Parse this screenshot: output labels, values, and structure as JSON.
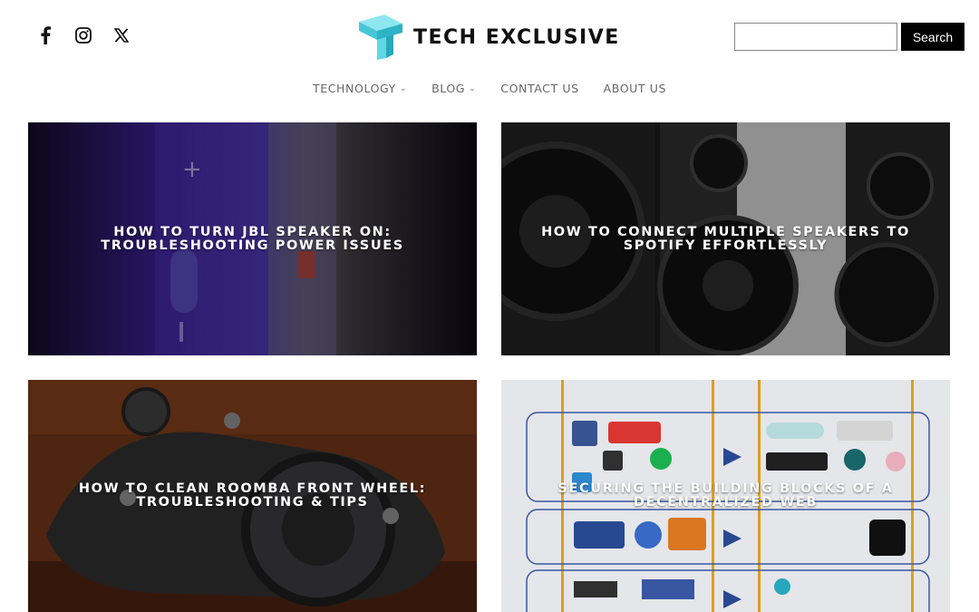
{
  "site": {
    "name": "TECH EXCLUSIVE"
  },
  "social": [
    "facebook-icon",
    "instagram-icon",
    "x-icon"
  ],
  "search": {
    "placeholder": "",
    "button_label": "Search"
  },
  "nav": [
    {
      "label": "TECHNOLOGY",
      "has_dropdown": true
    },
    {
      "label": "BLOG",
      "has_dropdown": true
    },
    {
      "label": "CONTACT US",
      "has_dropdown": false
    },
    {
      "label": "ABOUT US",
      "has_dropdown": false
    }
  ],
  "posts": [
    {
      "title": "HOW TO TURN JBL SPEAKER ON: TROUBLESHOOTING POWER ISSUES"
    },
    {
      "title": "HOW TO CONNECT MULTIPLE SPEAKERS TO SPOTIFY EFFORTLESSLY"
    },
    {
      "title": "HOW TO CLEAN ROOMBA FRONT WHEEL: TROUBLESHOOTING & TIPS"
    },
    {
      "title": "SECURING THE BUILDING BLOCKS OF A DECENTRALIZED WEB"
    }
  ],
  "colors": {
    "logo_accent": "#4fd3e0",
    "search_button": "#000000",
    "nav_text": "#666666"
  }
}
